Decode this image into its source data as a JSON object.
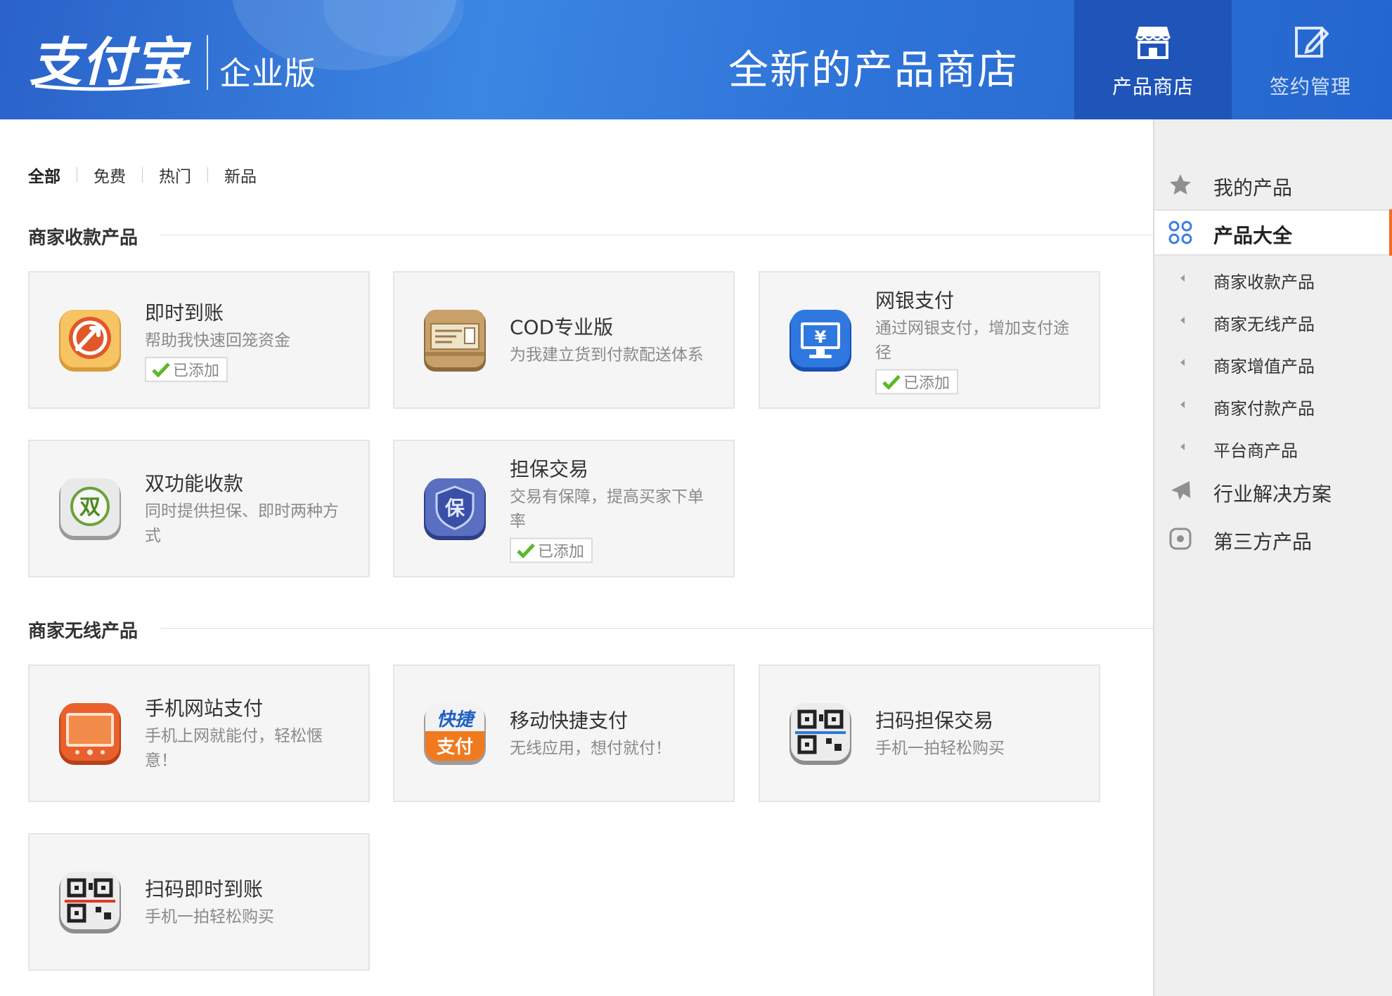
{
  "header": {
    "logo_text": "支付宝",
    "edition": "企业版",
    "title": "全新的产品商店",
    "tabs": [
      {
        "label": "产品商店",
        "icon": "store-icon",
        "active": true
      },
      {
        "label": "签约管理",
        "icon": "edit-icon",
        "active": false
      }
    ]
  },
  "filters": [
    "全部",
    "免费",
    "热门",
    "新品"
  ],
  "sections": [
    {
      "title": "商家收款产品",
      "cards": [
        {
          "name": "即时到账",
          "desc": "帮助我快速回笼资金",
          "added": "已添加",
          "icon": "instant-arrival-icon"
        },
        {
          "name": "COD专业版",
          "desc": "为我建立货到付款配送体系",
          "added": "",
          "icon": "cod-box-icon"
        },
        {
          "name": "网银支付",
          "desc": "通过网银支付，增加支付途径",
          "added": "已添加",
          "icon": "online-banking-icon"
        },
        {
          "name": "双功能收款",
          "desc": "同时提供担保、即时两种方式",
          "added": "",
          "icon": "dual-function-icon"
        },
        {
          "name": "担保交易",
          "desc": "交易有保障，提高买家下单率",
          "added": "已添加",
          "icon": "guarantee-icon"
        }
      ]
    },
    {
      "title": "商家无线产品",
      "cards": [
        {
          "name": "手机网站支付",
          "desc": "手机上网就能付，轻松惬意！",
          "added": "",
          "icon": "mobile-web-pay-icon"
        },
        {
          "name": "移动快捷支付",
          "desc": "无线应用，想付就付！",
          "added": "",
          "icon": "quick-pay-icon",
          "icon_text_1": "快捷",
          "icon_text_2": "支付"
        },
        {
          "name": "扫码担保交易",
          "desc": "手机一拍轻松购买",
          "added": "",
          "icon": "qr-guarantee-icon"
        },
        {
          "name": "扫码即时到账",
          "desc": "手机一拍轻松购买",
          "added": "",
          "icon": "qr-instant-icon"
        }
      ]
    }
  ],
  "sidebar": {
    "items": [
      {
        "label": "我的产品",
        "icon": "star-icon",
        "active": false
      },
      {
        "label": "产品大全",
        "icon": "grid-icon",
        "active": true
      }
    ],
    "sub_items": [
      "商家收款产品",
      "商家无线产品",
      "商家增值产品",
      "商家付款产品",
      "平台商产品"
    ],
    "bottom_items": [
      {
        "label": "行业解决方案",
        "icon": "plane-icon"
      },
      {
        "label": "第三方产品",
        "icon": "third-party-icon"
      }
    ]
  },
  "colors": {
    "header_blue": "#2f74d8",
    "active_tab": "#1f54b8",
    "accent_orange": "#f36c21",
    "check_green": "#5cb82a"
  }
}
